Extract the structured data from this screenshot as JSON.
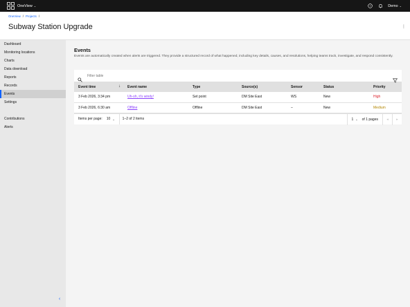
{
  "topbar": {
    "app_name": "OneView",
    "user_name": "Demo"
  },
  "header": {
    "breadcrumb": [
      "OneView",
      "Projects"
    ],
    "breadcrumb_separator": "/",
    "title": "Subway Station Upgrade"
  },
  "sidebar": {
    "items": [
      {
        "label": "Dashboard"
      },
      {
        "label": "Monitoring locations"
      },
      {
        "label": "Charts"
      },
      {
        "label": "Data download"
      },
      {
        "label": "Reports"
      },
      {
        "label": "Records"
      },
      {
        "label": "Events",
        "active": true
      },
      {
        "label": "Settings"
      }
    ],
    "secondary_items": [
      {
        "label": "Contributions"
      },
      {
        "label": "Alerts"
      }
    ]
  },
  "events": {
    "title": "Events",
    "description": "Events are automatically created when alerts are triggered. They provide a structured record of what happened, including key details, causes, and resolutions, helping teams track, investigate, and respond consistently.",
    "filter_placeholder": "Filter table",
    "columns": [
      "Event time",
      "Event name",
      "Type",
      "Source(s)",
      "Sensor",
      "Status",
      "Priority"
    ],
    "rows": [
      {
        "time": "3 Feb 2026, 3:34 pm",
        "name": "Uh-oh, it's windy!",
        "type": "Set point",
        "source": "DM Site East",
        "sensor": "WS",
        "status": "New",
        "priority": "High"
      },
      {
        "time": "3 Feb 2026, 6:30 am",
        "name": "Offline",
        "type": "Offline",
        "source": "DM Site East",
        "sensor": "–",
        "status": "New",
        "priority": "Medium"
      }
    ],
    "pagination": {
      "items_per_page_label": "Items per page:",
      "items_per_page": "10",
      "range": "1–2 of 2 items",
      "page": "1",
      "of_pages": "of 1 pages"
    }
  },
  "colors": {
    "accent": "#0f62fe",
    "link": "#8a3ffc",
    "high": "#da1e28",
    "medium": "#b28600",
    "topbar": "#161616"
  }
}
